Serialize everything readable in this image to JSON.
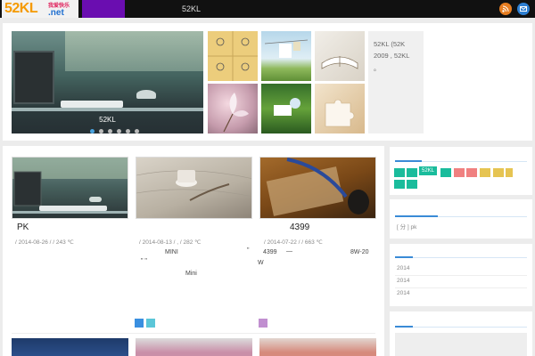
{
  "header": {
    "logo_main": "52KL",
    "logo_suffix": ".net",
    "logo_tagline": "我爱快乐",
    "site_title": "52KL",
    "rss_icon": "rss-icon",
    "mail_icon": "mail-icon",
    "active_nav_color": "#6a0db0"
  },
  "slider": {
    "caption": "52KL",
    "dot_count": 6,
    "active_dot": 0,
    "info_lines": [
      "52KL     (52K",
      "2009 , 52KL",
      "。"
    ]
  },
  "posts": [
    {
      "title": "PK",
      "meta": "/ 2014-08-26 /    / 243 ℃",
      "lines": []
    },
    {
      "title": "",
      "meta": "/ 2014-08-13 /      ,    / 282 ℃",
      "lines": [
        "MINI",
        "\"",
        "\"  \"",
        "Mini"
      ]
    },
    {
      "title": "4399",
      "meta": "/ 2014-07-22 /    / 663 ℃",
      "lines": [
        "4399",
        "—",
        "8W-20",
        "W"
      ]
    }
  ],
  "tag_colors": {
    "post2": [
      "#3a8fe0",
      "#5bc6d8"
    ],
    "post3": [
      "#c18fd0"
    ]
  },
  "sidebar": {
    "tag_cloud_label": "52KL",
    "tag_colors": [
      "#1abc9c",
      "#1abc9c",
      "#1abc9c",
      "#f08080",
      "#f08080",
      "#e6c452",
      "#e6c452",
      "#e6c452",
      "#1abc9c",
      "#1abc9c"
    ],
    "box2_text": "[ 分 ]  pk",
    "archive": [
      "2014",
      "2014",
      "2014"
    ]
  }
}
